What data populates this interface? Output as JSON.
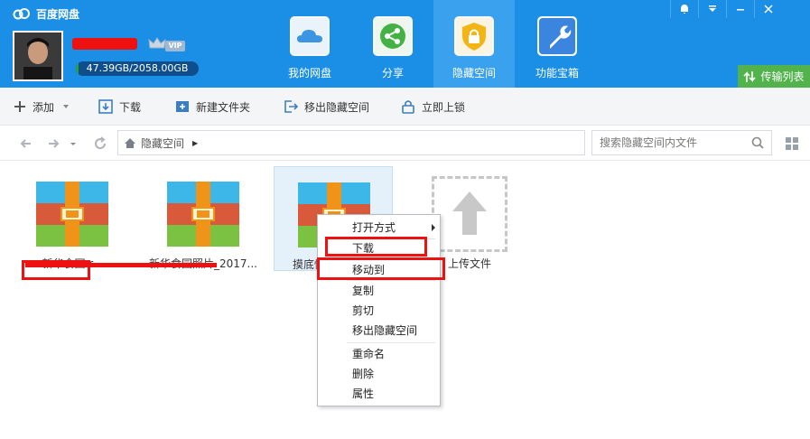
{
  "app": {
    "title": "百度网盘"
  },
  "user": {
    "vip_label": "VIP",
    "storage_text": "47.39GB/2058.00GB",
    "storage_used_fraction": 0.023
  },
  "nav_tabs": [
    {
      "label": "我的网盘",
      "icon": "cloud-icon",
      "color": "#3c95e0"
    },
    {
      "label": "分享",
      "icon": "share-icon",
      "color": "#43b245"
    },
    {
      "label": "隐藏空间",
      "icon": "lock-shield-icon",
      "color": "#f3b515"
    },
    {
      "label": "功能宝箱",
      "icon": "wrench-icon",
      "color": "#3c85de"
    }
  ],
  "window_controls": [
    "bell-icon",
    "menu-down-icon",
    "minimize-icon",
    "close-icon"
  ],
  "transfer_list": {
    "label": "传输列表"
  },
  "toolbar": {
    "add": "添加",
    "download": "下载",
    "new_folder": "新建文件夹",
    "move_out": "移出隐藏空间",
    "lock": "立即上锁"
  },
  "breadcrumb": {
    "path": "隐藏空间"
  },
  "search": {
    "placeholder": "搜索隐藏空间内文件"
  },
  "files": [
    {
      "name": "新华食园.r..."
    },
    {
      "name": "新华食园照片_2017..."
    },
    {
      "name": "摸底情况..."
    }
  ],
  "upload": {
    "label": "上传文件"
  },
  "context_menu": {
    "items": [
      "打开方式",
      "下载",
      "移动到",
      "复制",
      "剪切",
      "移出隐藏空间",
      "重命名",
      "删除",
      "属性"
    ]
  },
  "colors": {
    "header_blue": "#1b8fe6",
    "active_tab": "#3aa1ef",
    "annotation_red": "#ee1111",
    "archive_top": "#3db6e8",
    "archive_mid": "#d95a3a",
    "archive_bottom": "#7bc142",
    "archive_strap": "#ef9418"
  }
}
